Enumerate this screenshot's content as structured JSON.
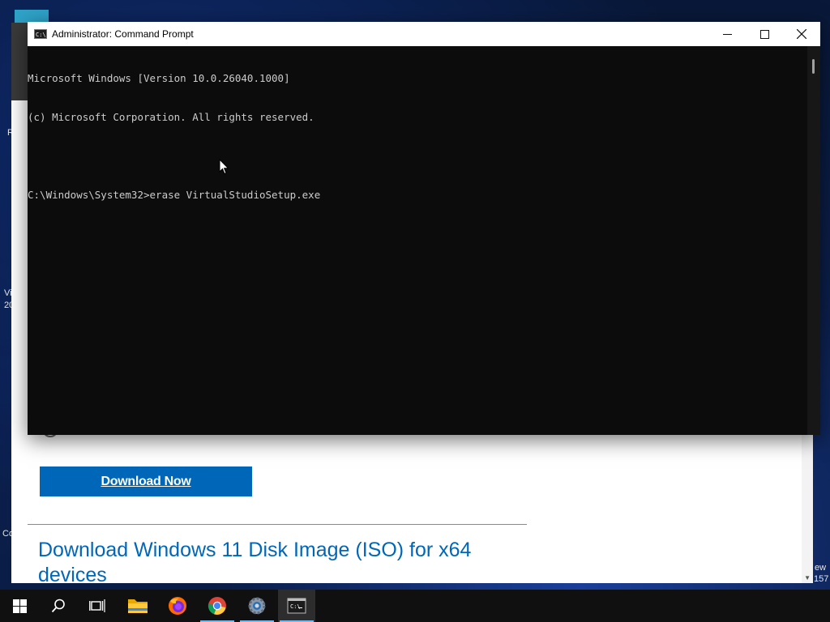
{
  "desktop": {
    "fragments": [
      "R",
      "Vi",
      "20",
      "Co",
      "ew",
      "157"
    ]
  },
  "browser": {
    "download_button": "Download Now",
    "section_heading": "Download Windows 11 Disk Image (ISO) for x64 devices"
  },
  "cmd_window": {
    "title": "Administrator: Command Prompt",
    "controls": {
      "minimize": "—",
      "maximize": "☐",
      "close": "✕"
    },
    "lines": [
      "Microsoft Windows [Version 10.0.26040.1000]",
      "(c) Microsoft Corporation. All rights reserved.",
      "",
      "C:\\Windows\\System32>erase VirtualStudioSetup.exe"
    ]
  },
  "taskbar": {
    "items": [
      {
        "name": "start",
        "icon": "windows-logo-icon"
      },
      {
        "name": "search",
        "icon": "search-icon"
      },
      {
        "name": "task-view",
        "icon": "task-view-icon"
      },
      {
        "name": "file-explorer",
        "icon": "folder-icon"
      },
      {
        "name": "firefox",
        "icon": "firefox-icon"
      },
      {
        "name": "chrome",
        "icon": "chrome-icon"
      },
      {
        "name": "settings",
        "icon": "gear-icon"
      },
      {
        "name": "command-prompt",
        "icon": "terminal-icon"
      }
    ]
  },
  "colors": {
    "accent": "#0067b8",
    "console_bg": "#0c0c0c",
    "console_text": "#cccccc",
    "taskbar_bg": "#101010",
    "active_indicator": "#76b9ed"
  }
}
